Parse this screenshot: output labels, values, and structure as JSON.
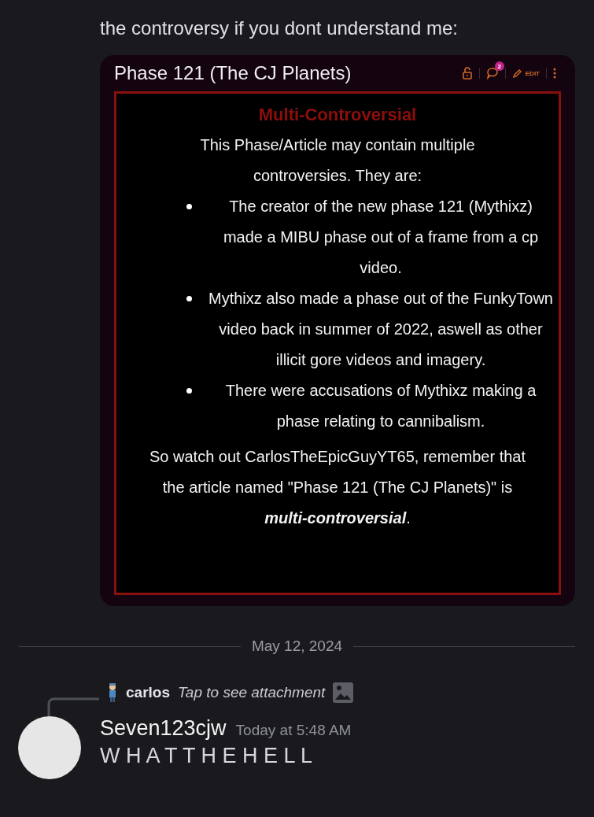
{
  "message_text": "the controversy if you dont understand me:",
  "attachment": {
    "title": "Phase 121 (The CJ Planets)",
    "comment_count": "2",
    "edit_label": "EDIT",
    "notice": {
      "heading": "Multi-Controversial",
      "intro": "This Phase/Article may contain multiple controversies. They are:",
      "bullets": [
        "The creator of the new phase 121 (Mythixz) made a MIBU phase out of a frame from a cp video.",
        "Mythixz also made a phase out of the FunkyTown video back in summer of 2022, aswell as other illicit gore videos and imagery.",
        "There were accusations of Mythixz making a phase relating to cannibalism."
      ],
      "closing": "So watch out CarlosTheEpicGuyYT65, remember that the article named \"Phase 121 (The CJ Planets)\" is **multi-controversial**."
    }
  },
  "date_divider": "May 12, 2024",
  "reply": {
    "author": "carlos",
    "preview": "Tap to see attachment"
  },
  "message": {
    "author": "Seven123cjw",
    "timestamp": "Today at 5:48 AM",
    "text": "W H A T T H E H E L L"
  }
}
